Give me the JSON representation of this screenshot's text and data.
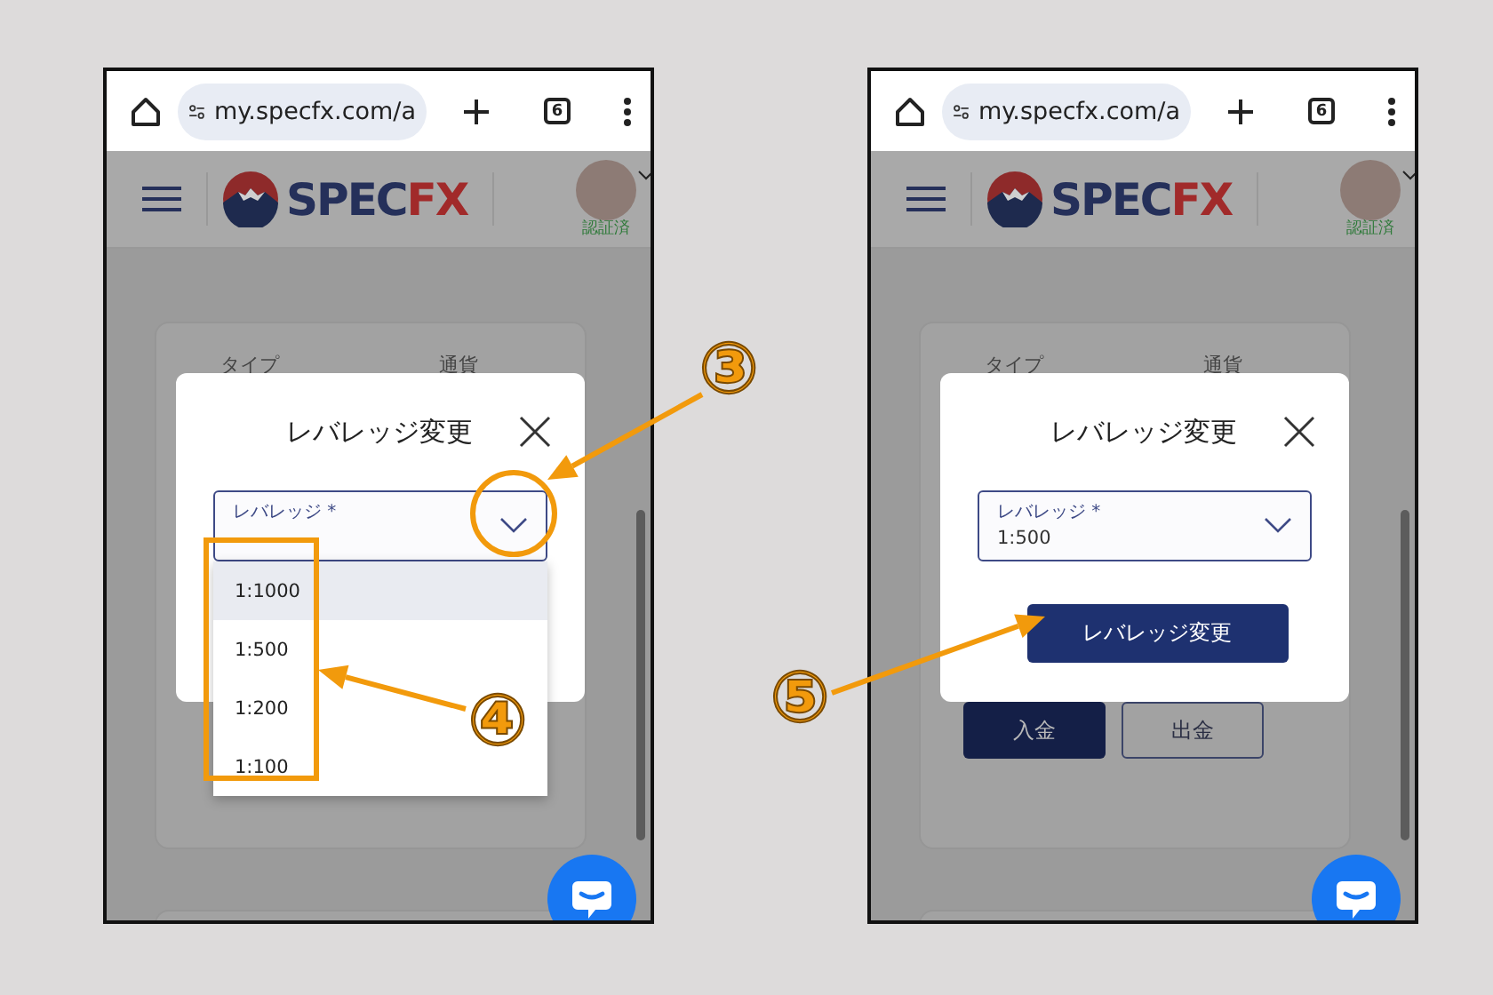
{
  "phones": [
    {
      "browser": {
        "url": "my.specfx.com/a",
        "tab_count": "6"
      },
      "site": {
        "logo": [
          "SPEC",
          "FX"
        ],
        "verified": "認証済"
      },
      "card": {
        "labels": [
          "タイプ",
          "通貨"
        ]
      },
      "dialog": {
        "title": "レバレッジ変更",
        "field": {
          "label": "レバレッジ *",
          "options": [
            {
              "label": "1:1000",
              "selected": true
            },
            {
              "label": "1:500",
              "selected": false
            },
            {
              "label": "1:200",
              "selected": false
            },
            {
              "label": "1:100",
              "selected": false
            }
          ]
        }
      }
    },
    {
      "browser": {
        "url": "my.specfx.com/a",
        "tab_count": "6"
      },
      "site": {
        "logo": [
          "SPEC",
          "FX"
        ],
        "verified": "認証済"
      },
      "card": {
        "labels": [
          "タイプ",
          "通貨"
        ],
        "buttons": [
          {
            "label": "入金",
            "kind": "primary"
          },
          {
            "label": "出金",
            "kind": "secondary"
          }
        ]
      },
      "dialog": {
        "title": "レバレッジ変更",
        "field": {
          "label": "レバレッジ *",
          "value": "1:500"
        },
        "submit": "レバレッジ変更"
      }
    }
  ],
  "annotations": [
    {
      "label": "③"
    },
    {
      "label": "④"
    },
    {
      "label": "⑤"
    }
  ]
}
